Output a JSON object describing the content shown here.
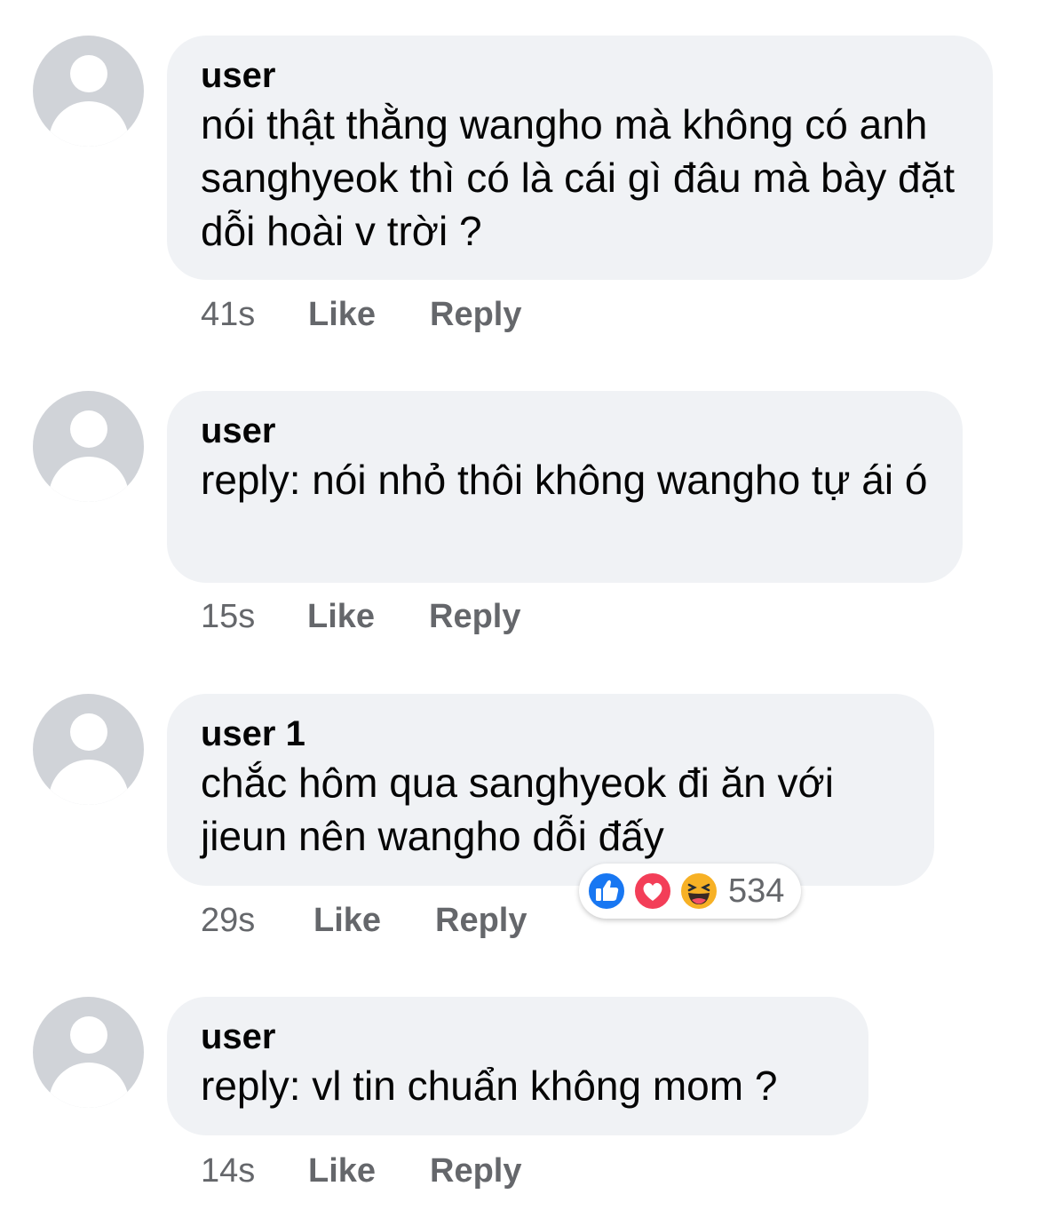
{
  "comments": [
    {
      "author": "user",
      "text": "nói thật thằng wangho mà không có anh sanghyeok thì có là cái gì đâu mà bày đặt dỗi hoài v trời ?",
      "time": "41s",
      "like_label": "Like",
      "reply_label": "Reply"
    },
    {
      "author": "user",
      "text": "reply: nói nhỏ thôi không wangho tự ái ó",
      "time": "15s",
      "like_label": "Like",
      "reply_label": "Reply"
    },
    {
      "author": "user 1",
      "text": "chắc hôm qua sanghyeok đi ăn với jieun nên wangho dỗi đấy",
      "time": "29s",
      "like_label": "Like",
      "reply_label": "Reply",
      "reactions": {
        "icons": [
          "like-icon",
          "love-icon",
          "haha-icon"
        ],
        "count": "534"
      }
    },
    {
      "author": "user",
      "text": "reply: vl tin chuẩn không mom ?",
      "time": "14s",
      "like_label": "Like",
      "reply_label": "Reply"
    }
  ],
  "colors": {
    "bubble_bg": "#f0f2f5",
    "meta_text": "#65676b",
    "like_blue": "#1877f2",
    "love_red": "#f33e58",
    "haha_yellow": "#f7b125"
  }
}
